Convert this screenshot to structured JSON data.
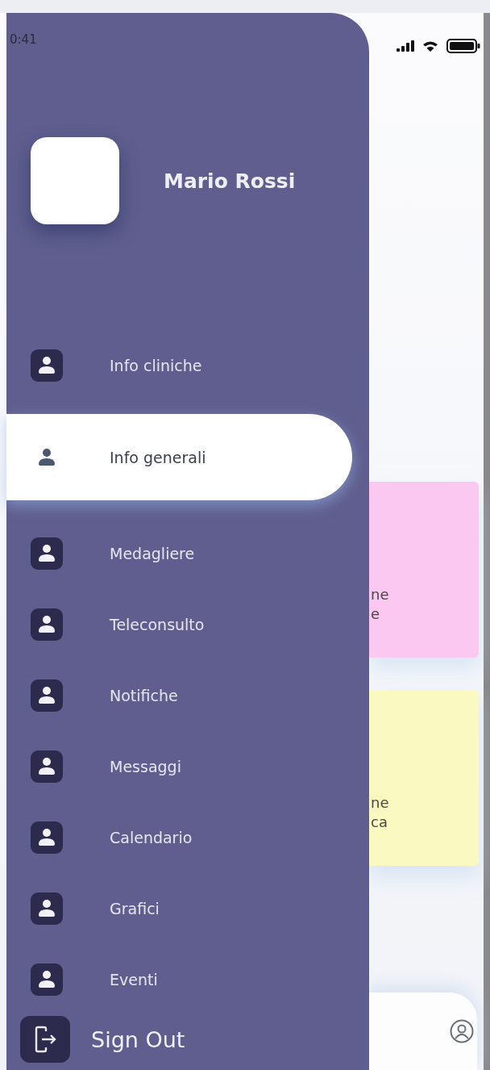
{
  "status_bar": {
    "time": "0:41"
  },
  "profile": {
    "name": "Mario Rossi"
  },
  "menu": [
    {
      "label": "Info cliniche",
      "selected": false
    },
    {
      "label": "Info generali",
      "selected": true
    },
    {
      "label": "Medagliere",
      "selected": false
    },
    {
      "label": "Teleconsulto",
      "selected": false
    },
    {
      "label": "Notifiche",
      "selected": false
    },
    {
      "label": "Messaggi",
      "selected": false
    },
    {
      "label": "Calendario",
      "selected": false
    },
    {
      "label": "Grafici",
      "selected": false
    },
    {
      "label": "Eventi",
      "selected": false
    }
  ],
  "sign_out": {
    "label": "Sign Out"
  },
  "background_cards": [
    {
      "lines": [
        "ne",
        "e"
      ],
      "color": "#fac8f0"
    },
    {
      "lines": [
        "ne",
        "ca"
      ],
      "color": "#fbf9c2"
    }
  ]
}
